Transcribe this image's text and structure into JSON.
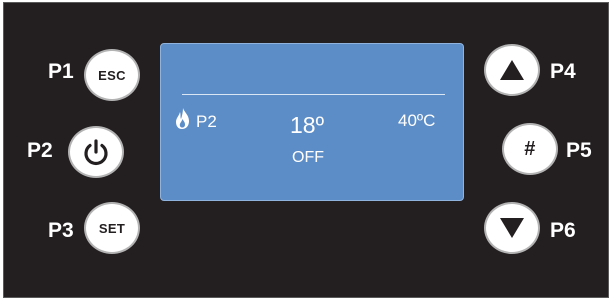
{
  "buttons": {
    "p1": {
      "label": "P1",
      "face": "ESC"
    },
    "p2": {
      "label": "P2",
      "icon": "power-icon"
    },
    "p3": {
      "label": "P3",
      "face": "SET"
    },
    "p4": {
      "label": "P4",
      "icon": "arrow-up-icon"
    },
    "p5": {
      "label": "P5",
      "face": "#"
    },
    "p6": {
      "label": "P6",
      "icon": "arrow-down-icon"
    }
  },
  "display": {
    "program": "P2",
    "program_icon": "flame-icon",
    "temperature": "18º",
    "setpoint": "40ºC",
    "status": "OFF"
  },
  "colors": {
    "panel": "#231f20",
    "screen": "#5d8dc7",
    "button_face": "#ffffff",
    "button_ring": "#b3b3b3"
  }
}
